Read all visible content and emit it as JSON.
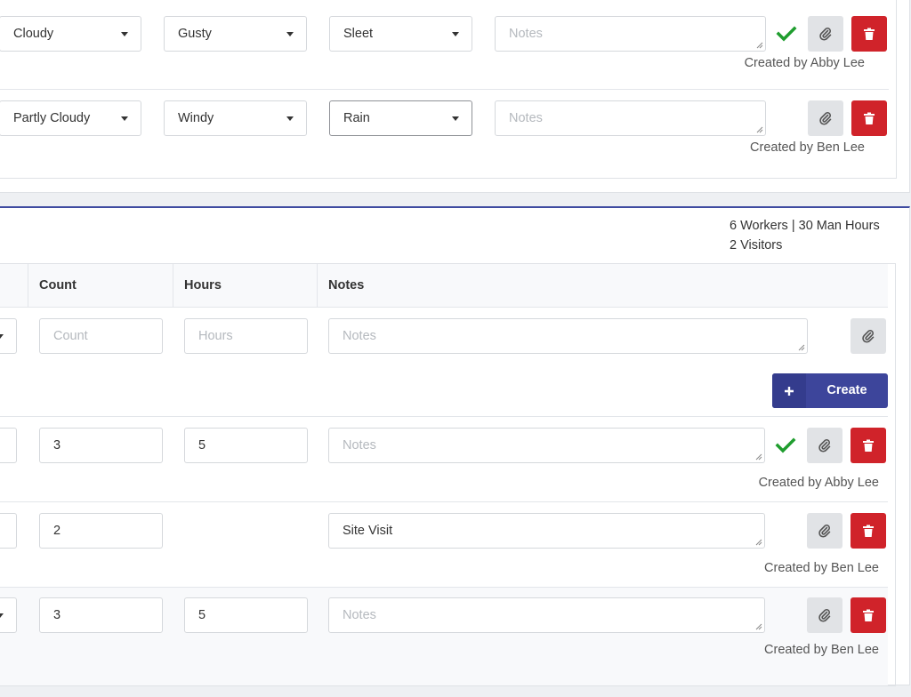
{
  "weather": {
    "rows": [
      {
        "sky": "Cloudy",
        "wind": "Gusty",
        "precip": "Sleet",
        "notes_placeholder": "Notes",
        "verified": true,
        "created_by": "Created by Abby Lee"
      },
      {
        "sky": "Partly Cloudy",
        "wind": "Windy",
        "precip": "Rain",
        "notes_placeholder": "Notes",
        "verified": false,
        "created_by": "Created by Ben Lee"
      }
    ]
  },
  "manpower": {
    "summary_line1": "6 Workers | 30 Man Hours",
    "summary_line2": "2 Visitors",
    "columns": {
      "count": "Count",
      "hours": "Hours",
      "notes": "Notes"
    },
    "new_row": {
      "count_placeholder": "Count",
      "hours_placeholder": "Hours",
      "notes_placeholder": "Notes"
    },
    "create_label": "Create",
    "rows": [
      {
        "count": "3",
        "hours": "5",
        "notes": "Notes",
        "notes_is_placeholder": true,
        "verified": true,
        "created_by": "Created by Abby Lee"
      },
      {
        "count": "2",
        "hours": "",
        "notes": "Site Visit",
        "notes_is_placeholder": false,
        "verified": false,
        "created_by": "Created by Ben Lee"
      },
      {
        "count": "3",
        "hours": "5",
        "notes": "Notes",
        "notes_is_placeholder": true,
        "verified": false,
        "created_by": "Created by Ben Lee"
      }
    ]
  },
  "colors": {
    "accent": "#3d459b",
    "danger": "#d0232a",
    "success": "#1f9d2e",
    "attach_bg": "#e1e3e6"
  },
  "icons": {
    "attach": "paperclip-icon",
    "delete": "trash-icon",
    "verified": "check-icon",
    "add": "plus-icon",
    "dropdown": "caret-down-icon"
  }
}
